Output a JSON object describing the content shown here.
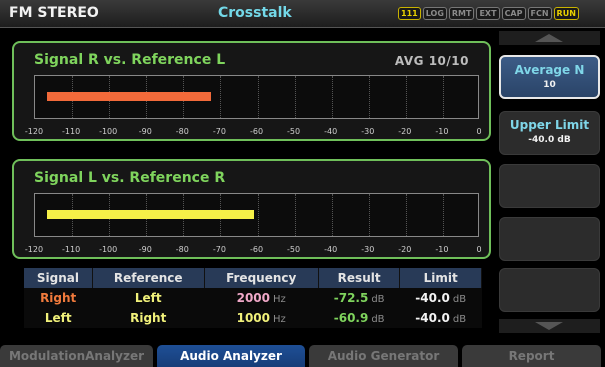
{
  "header": {
    "app_title": "FM STEREO",
    "page_title": "Crosstalk",
    "indicators": [
      {
        "label": "111",
        "active": true
      },
      {
        "label": "LOG",
        "active": false
      },
      {
        "label": "RMT",
        "active": false
      },
      {
        "label": "EXT",
        "active": false
      },
      {
        "label": "CAP",
        "active": false
      },
      {
        "label": "FCN",
        "active": false
      },
      {
        "label": "RUN",
        "active": true
      }
    ]
  },
  "scale_ticks": [
    "-120",
    "-110",
    "-100",
    "-90",
    "-80",
    "-70",
    "-60",
    "-50",
    "-40",
    "-30",
    "-20",
    "-10",
    "0"
  ],
  "scale_range": [
    -120,
    0
  ],
  "panels": [
    {
      "title": "Signal R vs. Reference L",
      "avg": "AVG 10/10",
      "value_db": -72.5,
      "bar_color": "#f26a3a"
    },
    {
      "title": "Signal L vs. Reference R",
      "avg": "",
      "value_db": -60.9,
      "bar_color": "#f5f048"
    }
  ],
  "table": {
    "headers": [
      "Signal",
      "Reference",
      "Frequency",
      "Result",
      "Limit"
    ],
    "rows": [
      {
        "signal": "Right",
        "reference": "Left",
        "frequency": "2000",
        "frequency_unit": "Hz",
        "result": "-72.5",
        "result_unit": "dB",
        "limit": "-40.0",
        "limit_unit": "dB"
      },
      {
        "signal": "Left",
        "reference": "Right",
        "frequency": "1000",
        "frequency_unit": "Hz",
        "result": "-60.9",
        "result_unit": "dB",
        "limit": "-40.0",
        "limit_unit": "dB"
      }
    ]
  },
  "softkeys": [
    {
      "label": "Average N",
      "value": "10",
      "selected": true
    },
    {
      "label": "Upper Limit",
      "value": "-40.0 dB",
      "selected": false
    },
    {
      "label": "",
      "value": "",
      "selected": false
    },
    {
      "label": "",
      "value": "",
      "selected": false
    },
    {
      "label": "",
      "value": "",
      "selected": false
    }
  ],
  "tabs": [
    {
      "label": "ModulationAnalyzer",
      "active": false
    },
    {
      "label": "Audio Analyzer",
      "active": true
    },
    {
      "label": "Audio Generator",
      "active": false
    },
    {
      "label": "Report",
      "active": false
    }
  ]
}
